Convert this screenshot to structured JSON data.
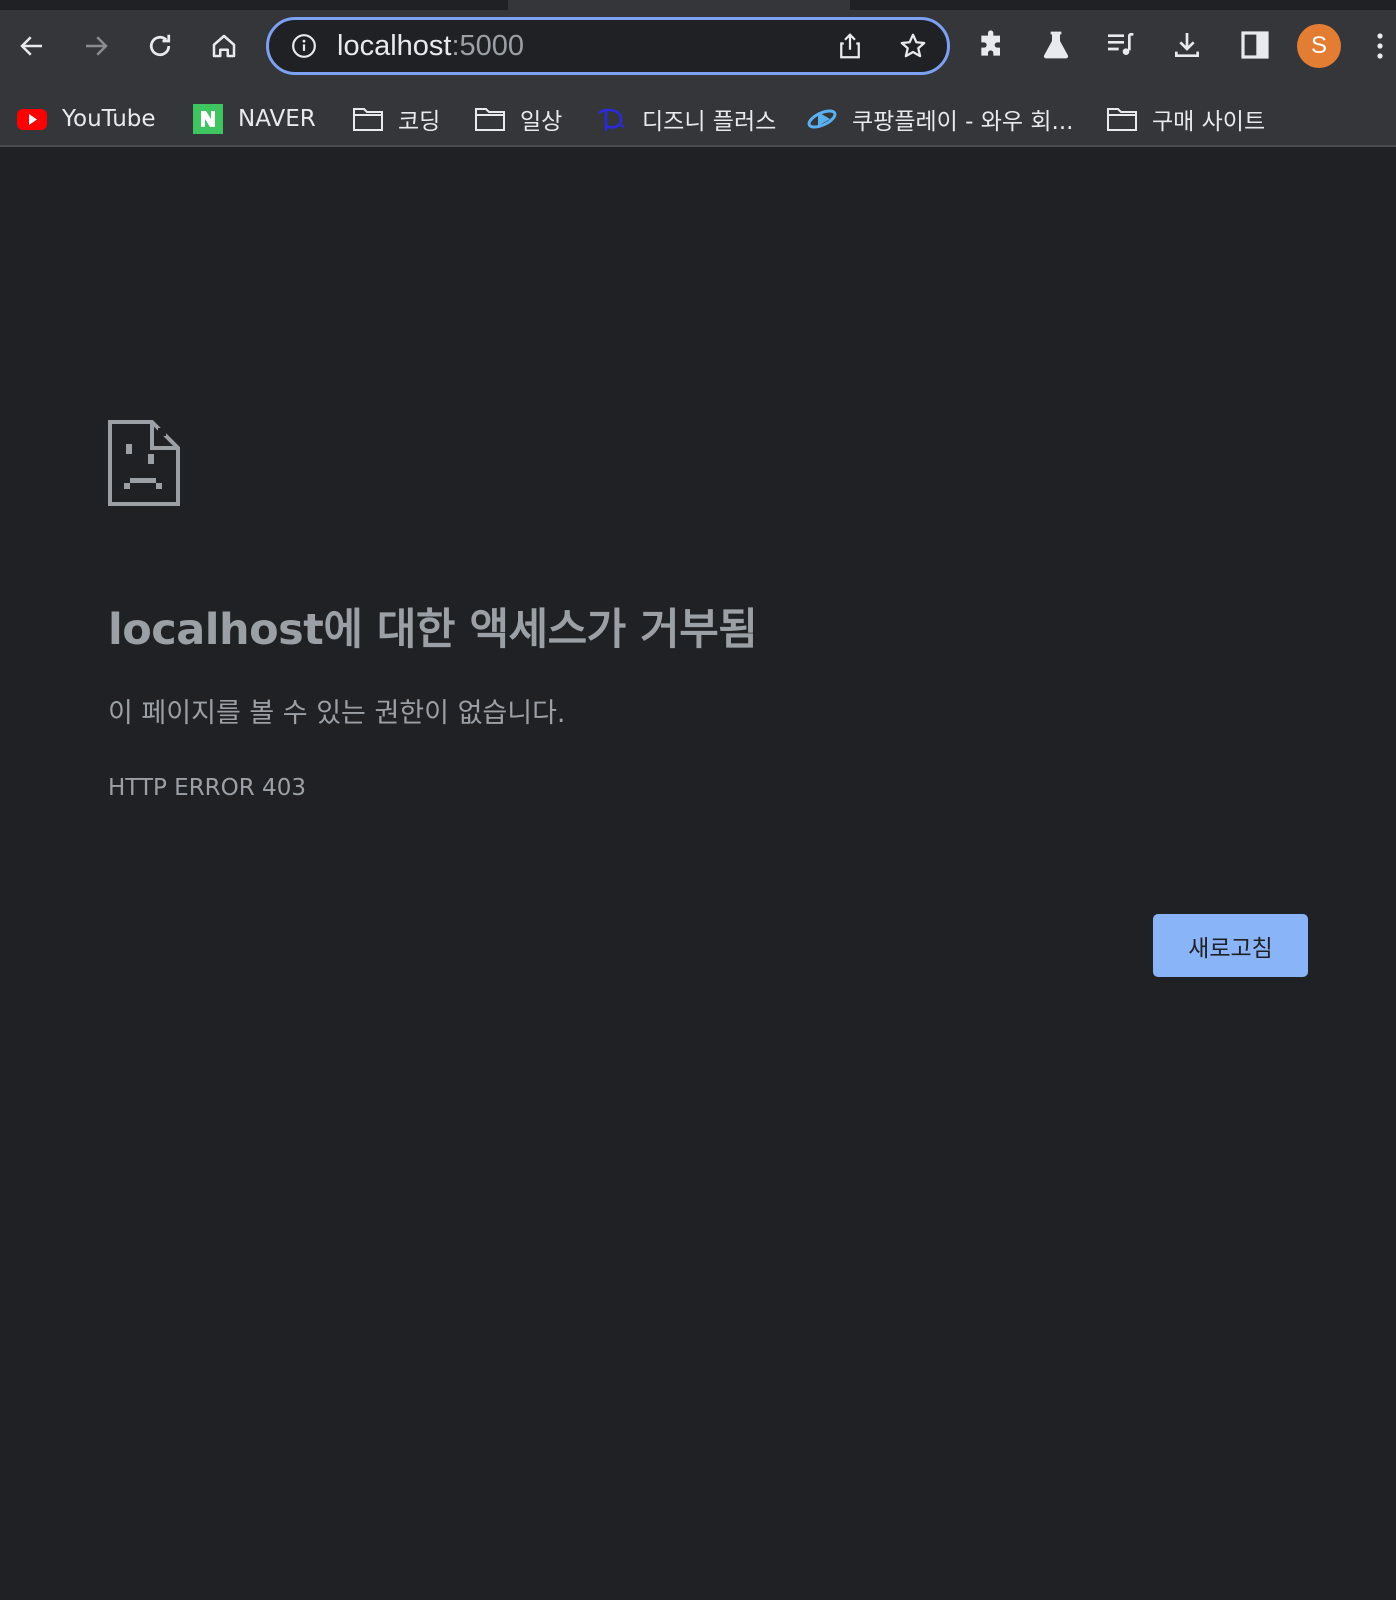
{
  "browser": {
    "address_bar": {
      "host": "localhost",
      "port": ":5000",
      "icon": "info-icon"
    },
    "toolbar_icons": [
      "back-icon",
      "forward-icon",
      "reload-icon",
      "home-icon",
      "share-icon",
      "star-icon",
      "extensions-icon",
      "labs-icon",
      "reading-list-icon",
      "download-icon",
      "side-panel-icon",
      "menu-icon"
    ],
    "profile_initial": "S",
    "accent_color": "#7ca1f2",
    "avatar_color": "#e37d34"
  },
  "bookmarks": [
    {
      "label": "YouTube",
      "icon": "youtube-icon"
    },
    {
      "label": "NAVER",
      "icon": "naver-icon"
    },
    {
      "label": "코딩",
      "icon": "folder-icon"
    },
    {
      "label": "일상",
      "icon": "folder-icon"
    },
    {
      "label": "디즈니 플러스",
      "icon": "disney-icon"
    },
    {
      "label": "쿠팡플레이 - 와우 회...",
      "icon": "coupang-play-icon"
    },
    {
      "label": "구매 사이트",
      "icon": "folder-icon"
    }
  ],
  "error_page": {
    "icon": "sad-document-icon",
    "heading": "localhost에 대한 액세스가 거부됨",
    "message": "이 페이지를 볼 수 있는 권한이 없습니다.",
    "code": "HTTP ERROR 403",
    "reload_label": "새로고침",
    "button_color": "#8ab4f8"
  }
}
